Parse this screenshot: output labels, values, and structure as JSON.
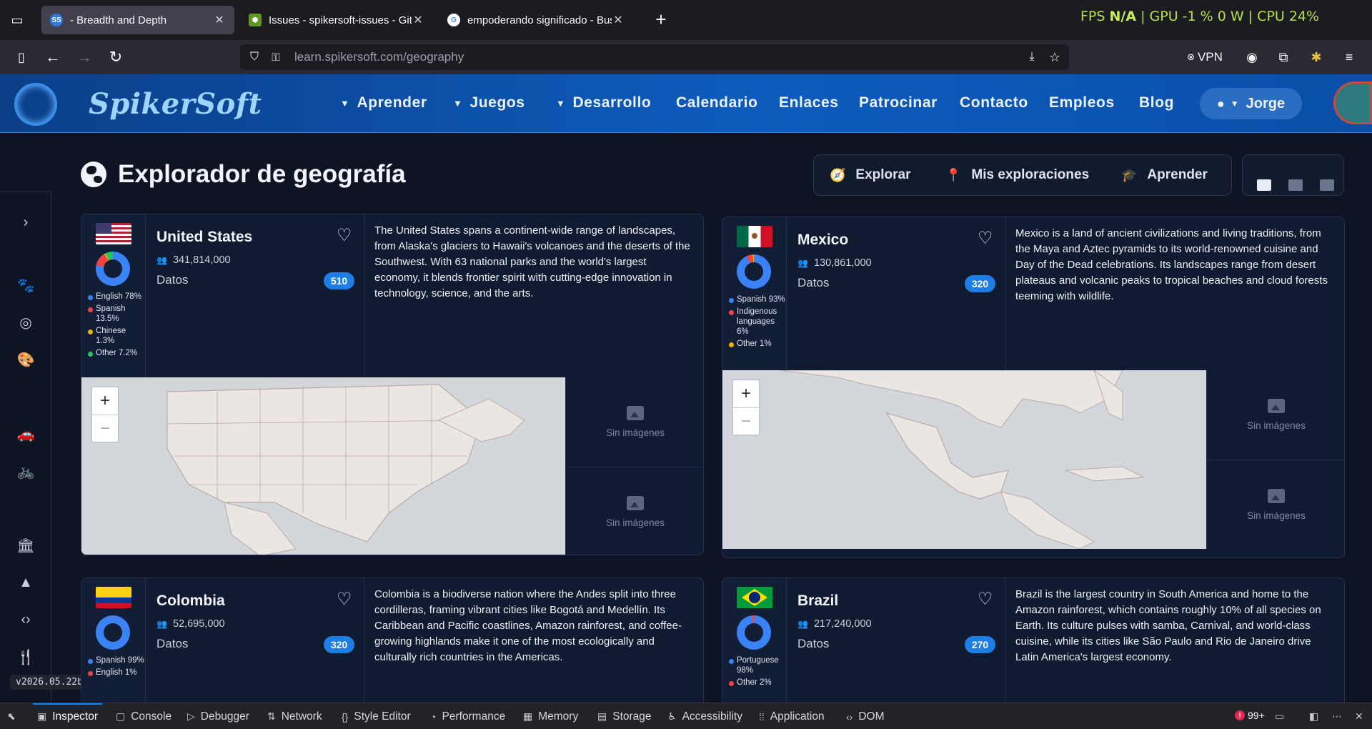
{
  "browser": {
    "tabs": [
      {
        "title": "- Breadth and Depth",
        "active": true
      },
      {
        "title": "Issues - spikersoft-issues - Gitea",
        "active": false
      },
      {
        "title": "empoderando significado - Bus",
        "active": false
      }
    ],
    "perf": {
      "fps_label": "FPS",
      "fps_value": "N/A",
      "gpu": "GPU -1 % 0 W",
      "cpu": "CPU 24%"
    },
    "url_host": "learn.spikersoft.com",
    "url_path": "/geography",
    "vpn_label": "VPN"
  },
  "site": {
    "logo": "SpikerSoft",
    "nav": [
      {
        "label": "Aprender",
        "dropdown": true
      },
      {
        "label": "Juegos",
        "dropdown": true
      },
      {
        "label": "Desarrollo",
        "dropdown": true
      },
      {
        "label": "Calendario"
      },
      {
        "label": "Enlaces"
      },
      {
        "label": "Patrocinar"
      },
      {
        "label": "Contacto"
      },
      {
        "label": "Empleos"
      },
      {
        "label": "Blog"
      }
    ],
    "user": "Jorge"
  },
  "page": {
    "title": "Explorador de geografía",
    "mode_tabs": [
      "Explorar",
      "Mis exploraciones",
      "Aprender"
    ]
  },
  "sidebar": {
    "icons": [
      "chevron-right-icon",
      "paw-icon",
      "target-icon",
      "palette-icon",
      "car-icon",
      "bicycle-icon",
      "building-icon",
      "mountain-icon",
      "code-icon",
      "utensils-icon"
    ],
    "version": "v2026.05.22b"
  },
  "countries": [
    {
      "name": "United States",
      "population": "341,814,000",
      "datos_label": "Datos",
      "datos_count": "510",
      "description": "The United States spans a continent-wide range of landscapes, from Alaska's glaciers to Hawaii's volcanoes and the deserts of the Southwest. With 63 national parks and the world's largest economy, it blends frontier spirit with cutting-edge innovation in technology, science, and the arts.",
      "languages": [
        {
          "label": "English 78%",
          "color": "#3b82f6"
        },
        {
          "label": "Spanish 13.5%",
          "color": "#ef4444"
        },
        {
          "label": "Chinese 1.3%",
          "color": "#eab308"
        },
        {
          "label": "Other 7.2%",
          "color": "#22c55e"
        }
      ],
      "no_images": [
        "Sin imágenes",
        "Sin imágenes"
      ]
    },
    {
      "name": "Mexico",
      "population": "130,861,000",
      "datos_label": "Datos",
      "datos_count": "320",
      "description": "Mexico is a land of ancient civilizations and living traditions, from the Maya and Aztec pyramids to its world-renowned cuisine and Day of the Dead celebrations. Its landscapes range from desert plateaus and volcanic peaks to tropical beaches and cloud forests teeming with wildlife.",
      "languages": [
        {
          "label": "Spanish 93%",
          "color": "#3b82f6"
        },
        {
          "label": "Indigenous languages 6%",
          "color": "#ef4444"
        },
        {
          "label": "Other 1%",
          "color": "#eab308"
        }
      ],
      "no_images": [
        "Sin imágenes",
        "Sin imágenes"
      ]
    },
    {
      "name": "Colombia",
      "population": "52,695,000",
      "datos_label": "Datos",
      "datos_count": "320",
      "description": "Colombia is a biodiverse nation where the Andes split into three cordilleras, framing vibrant cities like Bogotá and Medellín. Its Caribbean and Pacific coastlines, Amazon rainforest, and coffee-growing highlands make it one of the most ecologically and culturally rich countries in the Americas.",
      "languages": [
        {
          "label": "Spanish 99%",
          "color": "#3b82f6"
        },
        {
          "label": "English 1%",
          "color": "#ef4444"
        }
      ]
    },
    {
      "name": "Brazil",
      "population": "217,240,000",
      "datos_label": "Datos",
      "datos_count": "270",
      "description": "Brazil is the largest country in South America and home to the Amazon rainforest, which contains roughly 10% of all species on Earth. Its culture pulses with samba, Carnival, and world-class cuisine, while its cities like São Paulo and Rio de Janeiro drive Latin America's largest economy.",
      "languages": [
        {
          "label": "Portuguese 98%",
          "color": "#3b82f6"
        },
        {
          "label": "Other 2%",
          "color": "#ef4444"
        }
      ]
    }
  ],
  "map": {
    "zoom_in": "+",
    "zoom_out": "−"
  },
  "devtools": {
    "tabs": [
      "Inspector",
      "Console",
      "Debugger",
      "Network",
      "Style Editor",
      "Performance",
      "Memory",
      "Storage",
      "Accessibility",
      "Application",
      "DOM"
    ],
    "error_count": "99+"
  }
}
